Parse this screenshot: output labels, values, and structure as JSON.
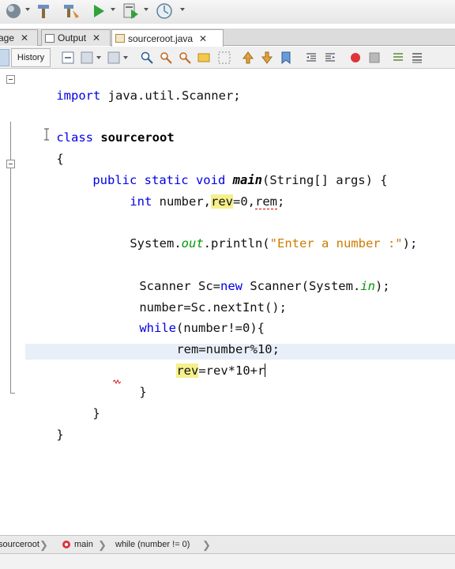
{
  "toolbar": {
    "icons": [
      "globe-icon",
      "build-hammer-icon",
      "clean-build-icon",
      "run-icon",
      "debug-icon",
      "profile-icon"
    ]
  },
  "tabs": [
    {
      "label": "age",
      "active": false
    },
    {
      "label": "Output",
      "active": false
    },
    {
      "label": "sourceroot.java",
      "active": true
    }
  ],
  "editor_toolbar": {
    "source_label": "",
    "history_label": "History"
  },
  "code": {
    "line1_import": "import",
    "line1_rest": " java.util.Scanner;",
    "line2_class_kw": "class",
    "line2_class_name": "sourceroot",
    "line3_brace": "{",
    "line4_modifiers": "public static void",
    "line4_method": "main",
    "line4_params": "(String[] args) {",
    "line5_type": "int",
    "line5_a": " number,",
    "line5_rev": "rev",
    "line5_b": "=0,",
    "line5_rem": "rem",
    "line5_c": ";",
    "line6_system": "System.",
    "line6_out": "out",
    "line6_println": ".println(",
    "line6_string": "\"Enter a number :\"",
    "line6_end": ");",
    "line7_a": "Scanner Sc=",
    "line7_new": "new",
    "line7_b": " Scanner(System.",
    "line7_in": "in",
    "line7_c": ");",
    "line8": "number=Sc.nextInt();",
    "line9_while": "while",
    "line9_rest": "(number!=0){",
    "line10": "rem=number%10;",
    "line11_rev": "rev",
    "line11_rest": "=rev*10+r",
    "line12_brace": "}",
    "line13_brace": "}",
    "line14_brace": "}"
  },
  "breadcrumb": {
    "class": "sourceroot",
    "method": "main",
    "block": "while (number != 0)"
  },
  "colors": {
    "keyword": "#0000e6",
    "string": "#ce7b00",
    "field": "#009900",
    "highlight": "#f5f08c",
    "current_line": "#e9eff8"
  }
}
